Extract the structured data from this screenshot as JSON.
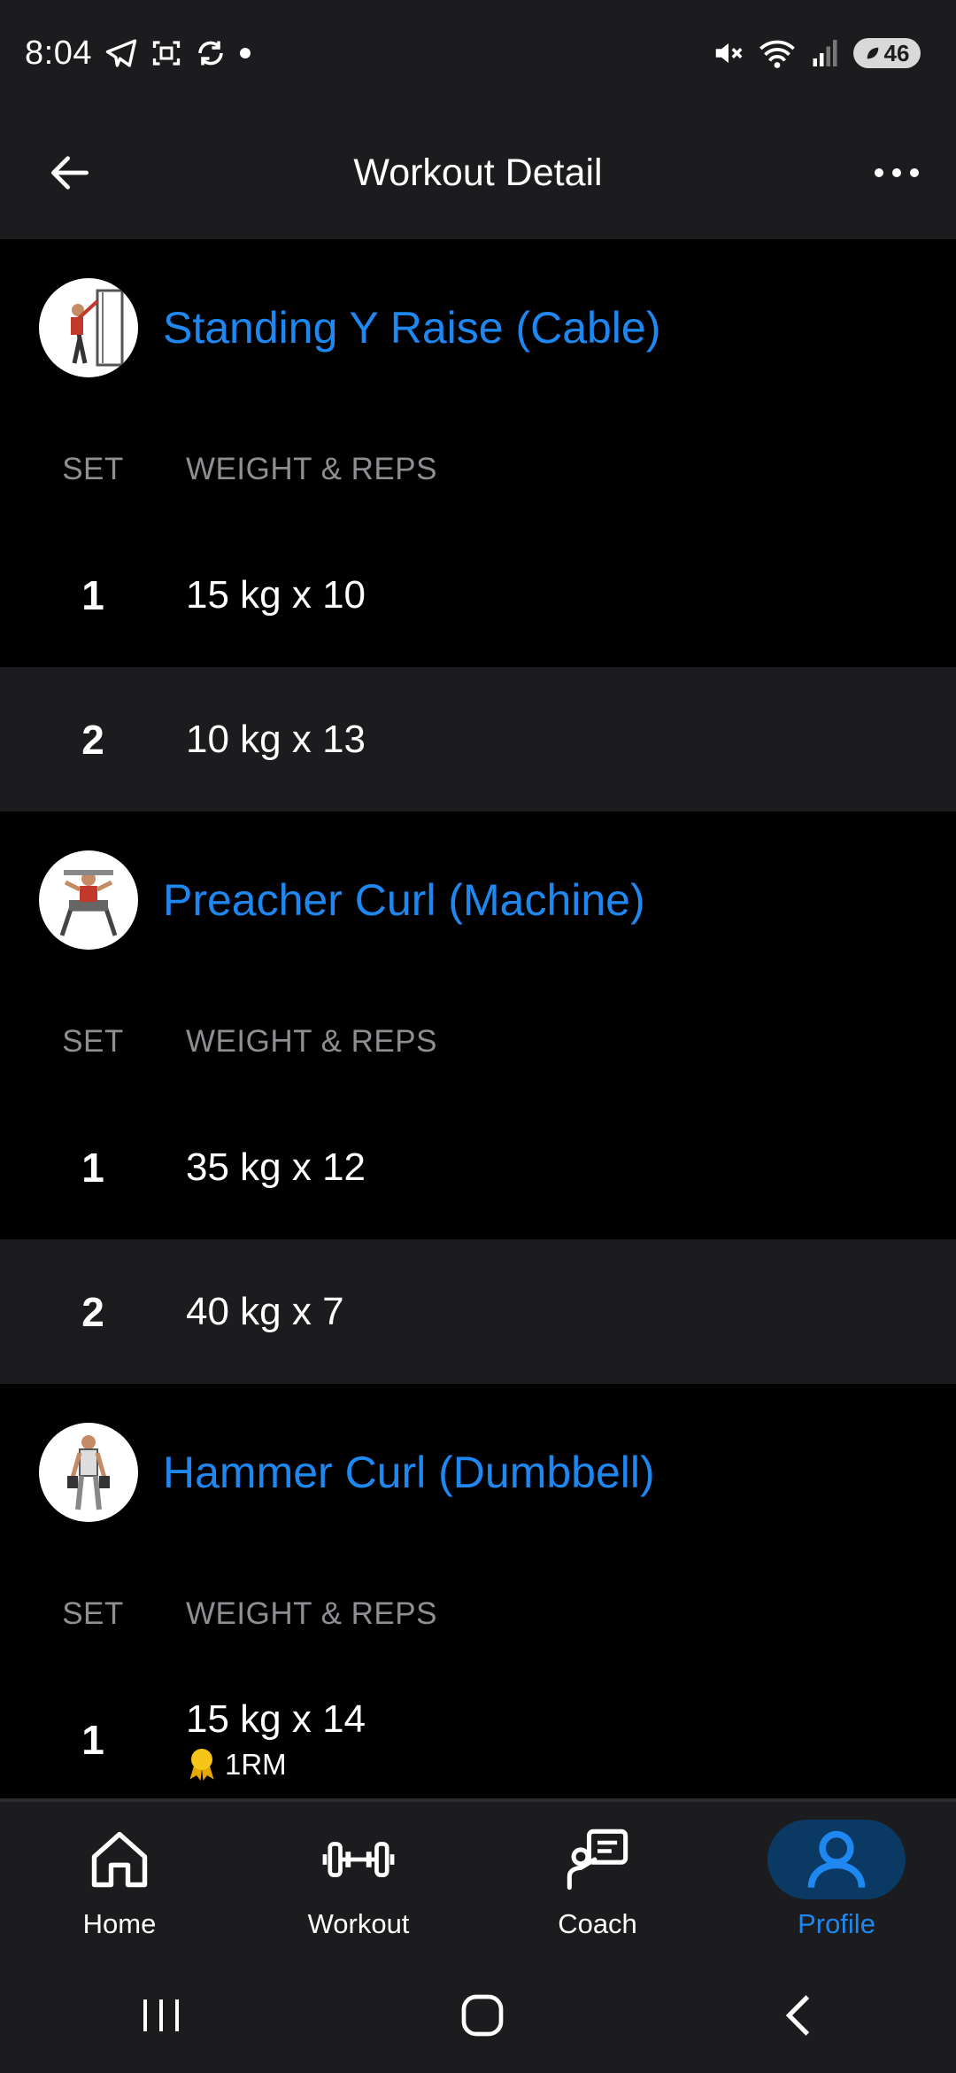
{
  "status_bar": {
    "time": "8:04",
    "battery": "46"
  },
  "app_bar": {
    "title": "Workout Detail"
  },
  "exercises": [
    {
      "name": "Standing Y Raise (Cable)",
      "headers": {
        "set": "SET",
        "weight_reps": "WEIGHT & REPS"
      },
      "sets": [
        {
          "num": "1",
          "value": "15 kg x 10"
        },
        {
          "num": "2",
          "value": "10 kg x 13"
        }
      ]
    },
    {
      "name": "Preacher Curl (Machine)",
      "headers": {
        "set": "SET",
        "weight_reps": "WEIGHT & REPS"
      },
      "sets": [
        {
          "num": "1",
          "value": "35 kg x 12"
        },
        {
          "num": "2",
          "value": "40 kg x 7"
        }
      ]
    },
    {
      "name": "Hammer Curl (Dumbbell)",
      "headers": {
        "set": "SET",
        "weight_reps": "WEIGHT & REPS"
      },
      "sets": [
        {
          "num": "1",
          "value": "15 kg x 14",
          "badge": "1RM"
        }
      ]
    }
  ],
  "bottom_nav": {
    "items": [
      {
        "label": "Home",
        "icon": "home-icon"
      },
      {
        "label": "Workout",
        "icon": "dumbbell-icon"
      },
      {
        "label": "Coach",
        "icon": "coach-icon"
      },
      {
        "label": "Profile",
        "icon": "profile-icon",
        "active": true
      }
    ]
  },
  "colors": {
    "accent": "#1e87f0",
    "background": "#000000",
    "surface": "#1c1c1e",
    "muted": "#8e8e93"
  }
}
